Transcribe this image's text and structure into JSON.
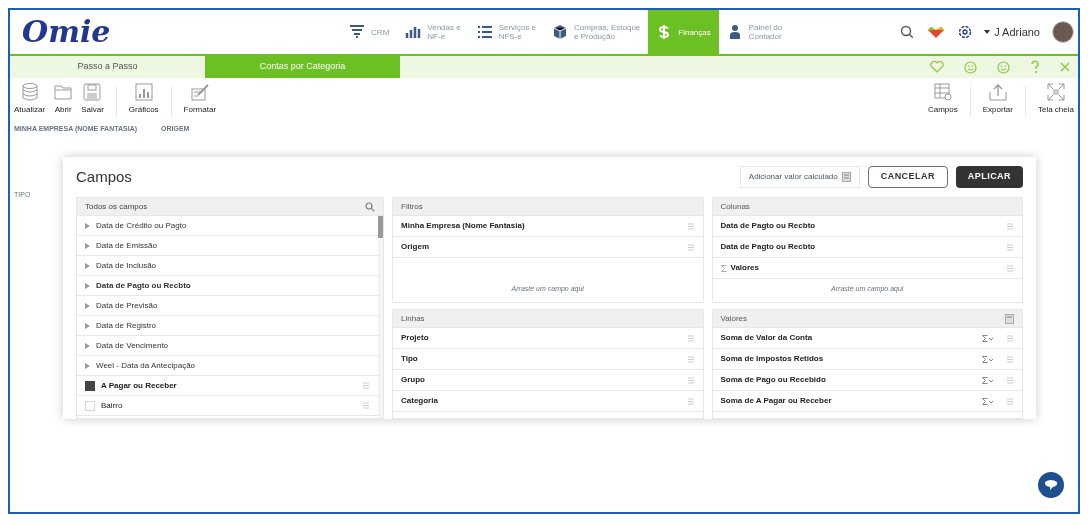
{
  "header": {
    "logo": "Omie",
    "nav": [
      {
        "label": "CRM",
        "selected": false
      },
      {
        "label": "Vendas e\nNF-e",
        "selected": false
      },
      {
        "label": "Serviços e\nNFS-e",
        "selected": false
      },
      {
        "label": "Compras, Estoque\ne Produção",
        "selected": false
      },
      {
        "label": "Finanças",
        "selected": true
      },
      {
        "label": "Painel do\nContador",
        "selected": false
      }
    ],
    "user": "J Adriano"
  },
  "tabs": [
    {
      "label": "Passo a Passo",
      "selected": false
    },
    {
      "label": "Contas por Categoria",
      "selected": true
    }
  ],
  "toolbar_left": [
    "Atualizar",
    "Abrir",
    "Salvar",
    "Gráficos",
    "Formatar"
  ],
  "toolbar_right": [
    "Campos",
    "Exportar",
    "Tela cheia"
  ],
  "background": {
    "filters": [
      "MINHA EMPRESA (NOME FANTASIA)",
      "ORIGEM"
    ],
    "row_header": "TIPO"
  },
  "dialog": {
    "title": "Campos",
    "calc_button": "Adicionar valor calculado",
    "cancel": "CANCELAR",
    "apply": "APLICAR",
    "all_fields": {
      "header": "Todos os campos",
      "items": [
        {
          "kind": "group",
          "label": "Data de Crédito ou Pagto",
          "used": false
        },
        {
          "kind": "group",
          "label": "Data de Emissão",
          "used": false
        },
        {
          "kind": "group",
          "label": "Data de Inclusão",
          "used": false
        },
        {
          "kind": "group",
          "label": "Data de Pagto ou Recbto",
          "used": true
        },
        {
          "kind": "group",
          "label": "Data de Previsão",
          "used": false
        },
        {
          "kind": "group",
          "label": "Data de Registro",
          "used": false
        },
        {
          "kind": "group",
          "label": "Data de Vencimento",
          "used": false
        },
        {
          "kind": "group",
          "label": "Weel - Data da Antecipação",
          "used": false
        },
        {
          "kind": "field",
          "label": "A Pagar ou Receber",
          "checked": true
        },
        {
          "kind": "field",
          "label": "Bairro",
          "checked": false
        }
      ]
    },
    "sections": [
      {
        "kind": "filters",
        "header": "Filtros",
        "items": [
          {
            "kind": "field",
            "label": "Minha Empresa (Nome Fantasia)"
          },
          {
            "kind": "field",
            "label": "Origem"
          }
        ],
        "dropzone": "Arraste um campo aqui"
      },
      {
        "kind": "columns",
        "header": "Colunas",
        "items": [
          {
            "kind": "field",
            "label": "Data de Pagto ou Recbto"
          },
          {
            "kind": "field",
            "label": "Data de Pagto ou Recbto"
          },
          {
            "kind": "values",
            "label": "Valores"
          }
        ],
        "dropzone": "Arraste um campo aqui"
      },
      {
        "kind": "rows",
        "header": "Linhas",
        "items": [
          {
            "kind": "field",
            "label": "Projeto"
          },
          {
            "kind": "field",
            "label": "Tipo"
          },
          {
            "kind": "field",
            "label": "Grupo"
          },
          {
            "kind": "field",
            "label": "Categoria"
          }
        ]
      },
      {
        "kind": "values",
        "header": "Valores",
        "items": [
          {
            "kind": "measure",
            "label": "Soma de Valor da Conta"
          },
          {
            "kind": "measure",
            "label": "Soma de Impostos Retidos"
          },
          {
            "kind": "measure",
            "label": "Soma de Pago ou Recebido"
          },
          {
            "kind": "measure",
            "label": "Soma de A Pagar ou Receber"
          }
        ]
      }
    ]
  }
}
